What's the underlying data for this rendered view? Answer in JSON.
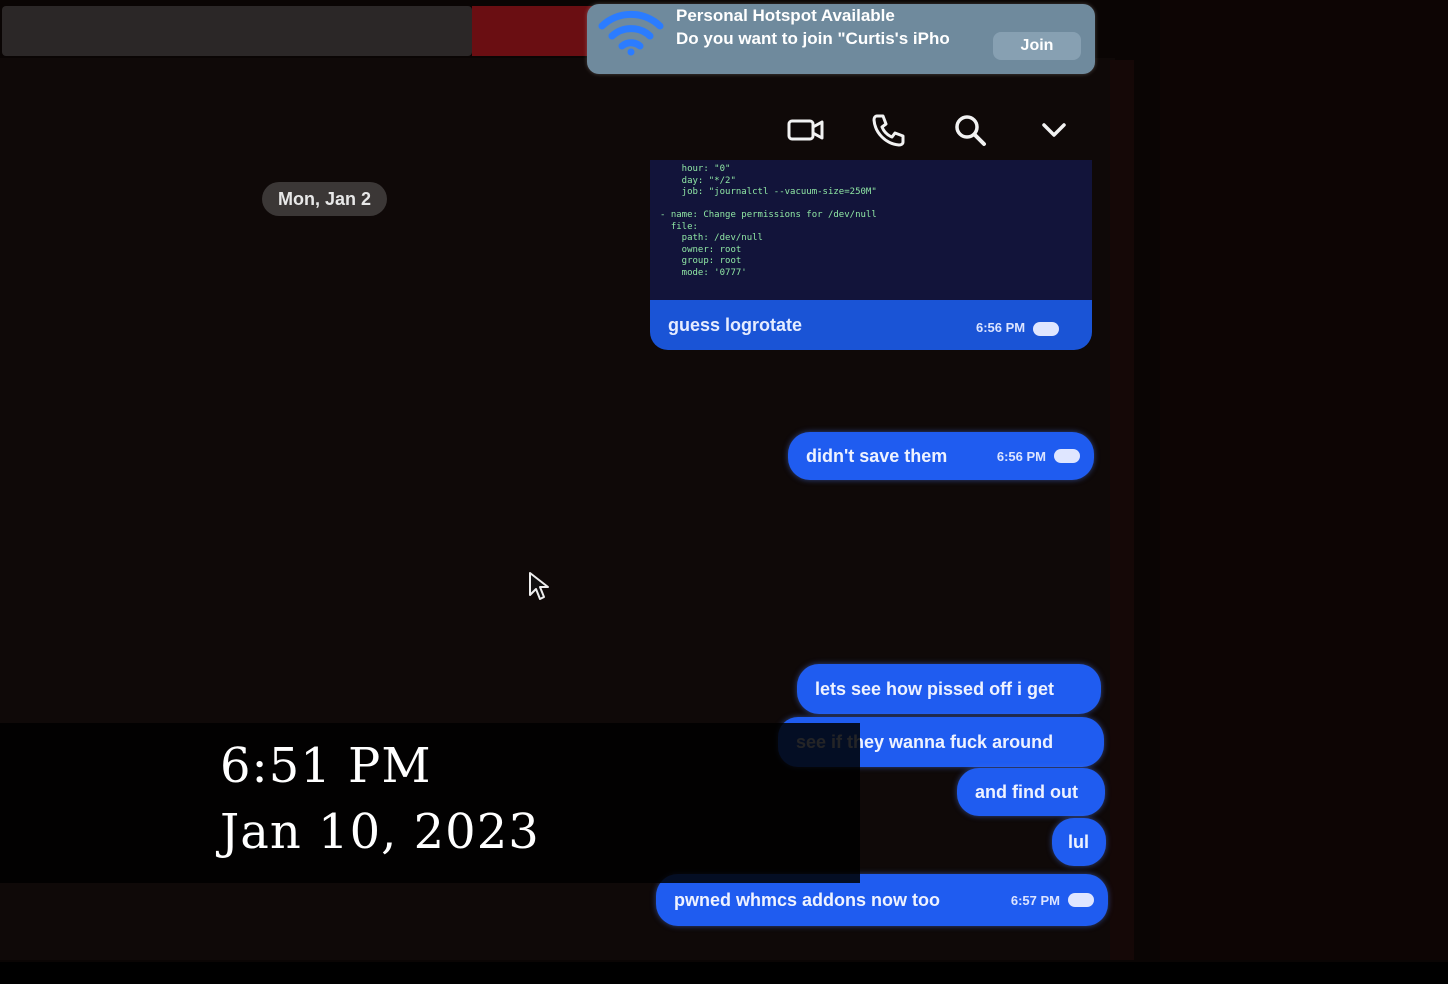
{
  "notification": {
    "title": "Personal Hotspot Available",
    "body": "Do you want to join \"Curtis's iPho",
    "join_label": "Join",
    "wifi_icon": "wifi-icon"
  },
  "header": {
    "icons": [
      "video-camera-icon",
      "phone-icon",
      "search-icon",
      "chevron-down-icon"
    ]
  },
  "chat": {
    "date_separator": "Mon, Jan 2",
    "code_snippet": {
      "lines": [
        "    hour: \"0\"",
        "    day: \"*/2\"",
        "    job: \"journalctl --vacuum-size=250M\"",
        "",
        "- name: Change permissions for /dev/null",
        "  file:",
        "    path: /dev/null",
        "    owner: root",
        "    group: root",
        "    mode: '0777'"
      ],
      "caption": "guess logrotate",
      "time": "6:56 PM"
    },
    "messages": [
      {
        "text": "didn't save them",
        "time": "6:56 PM"
      },
      {
        "text": "lets see how pissed off i get",
        "time": ""
      },
      {
        "text": "see if they wanna fuck around",
        "time": ""
      },
      {
        "text": "and find out",
        "time": ""
      },
      {
        "text": "lul",
        "time": ""
      },
      {
        "text": "pwned whmcs addons now too",
        "time": "6:57 PM"
      }
    ]
  },
  "overlay": {
    "time": "6:51 PM",
    "date": "Jan 10, 2023"
  },
  "colors": {
    "bubble": "#1f5cf0",
    "background": "#0f0908",
    "notification": "#6f8a9d"
  }
}
